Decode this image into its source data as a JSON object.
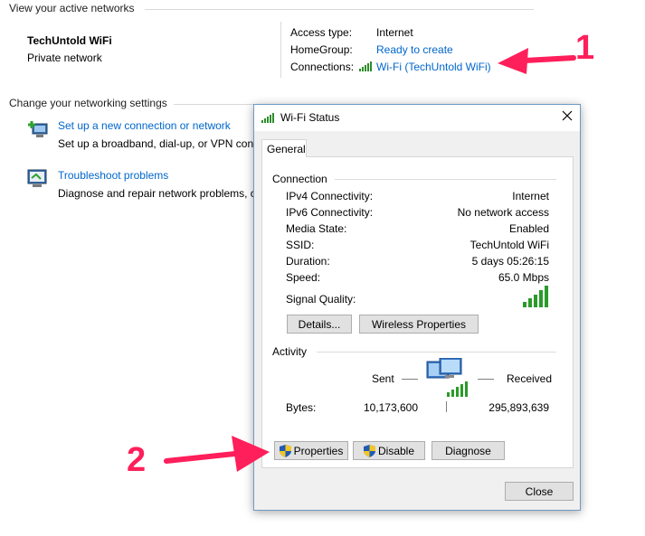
{
  "active_networks": {
    "heading": "View your active networks",
    "network_name": "TechUntold WiFi",
    "network_type": "Private network",
    "access_type_label": "Access type:",
    "access_type_value": "Internet",
    "homegroup_label": "HomeGroup:",
    "homegroup_value": "Ready to create",
    "connections_label": "Connections:",
    "connections_value": "Wi-Fi (TechUntold WiFi)"
  },
  "settings": {
    "heading": "Change your networking settings",
    "items": [
      {
        "title": "Set up a new connection or network",
        "desc": "Set up a broadband, dial-up, or VPN conn"
      },
      {
        "title": "Troubleshoot problems",
        "desc": "Diagnose and repair network problems, c"
      }
    ]
  },
  "dialog": {
    "title": "Wi-Fi Status",
    "tab": "General",
    "connection_group": "Connection",
    "rows": [
      {
        "label": "IPv4 Connectivity:",
        "value": "Internet"
      },
      {
        "label": "IPv6 Connectivity:",
        "value": "No network access"
      },
      {
        "label": "Media State:",
        "value": "Enabled"
      },
      {
        "label": "SSID:",
        "value": "TechUntold WiFi"
      },
      {
        "label": "Duration:",
        "value": "5 days 05:26:15"
      },
      {
        "label": "Speed:",
        "value": "65.0 Mbps"
      }
    ],
    "signal_quality_label": "Signal Quality:",
    "signal_bars": 5,
    "details_button": "Details...",
    "wireless_properties_button": "Wireless Properties",
    "activity_group": "Activity",
    "sent_label": "Sent",
    "received_label": "Received",
    "bytes_label": "Bytes:",
    "bytes_sent": "10,173,600",
    "bytes_received": "295,893,639",
    "properties_button": "Properties",
    "disable_button": "Disable",
    "diagnose_button": "Diagnose",
    "close_button": "Close"
  },
  "annotations": {
    "marker_1": "1",
    "marker_2": "2",
    "arrow_color": "#ff1f5a"
  }
}
